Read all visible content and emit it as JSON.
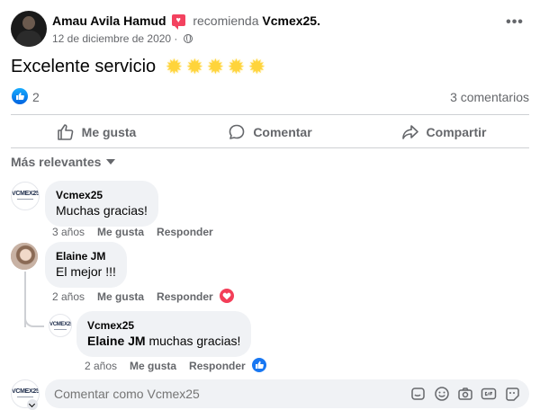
{
  "post": {
    "author": "Amau Avila Hamud",
    "recommend_text": "recomienda",
    "page": "Vcmex25.",
    "date": "12 de diciembre de 2020",
    "date_sep": " · ",
    "text": "Excelente servicio",
    "star_count": 5,
    "more_icon": "•••"
  },
  "reactions": {
    "like_count": "2",
    "comments": "3 comentarios"
  },
  "actions": {
    "like": "Me gusta",
    "comment": "Comentar",
    "share": "Compartir"
  },
  "sort": {
    "label": "Más relevantes"
  },
  "logo_text": "VCMEX25",
  "comments": [
    {
      "name": "Vcmex25",
      "text": "Muchas gracias!",
      "time": "3 años",
      "like": "Me gusta",
      "reply": "Responder"
    },
    {
      "name": "Elaine JM",
      "text": "El mejor !!!",
      "time": "2 años",
      "like": "Me gusta",
      "reply": "Responder",
      "reaction": "love"
    }
  ],
  "reply": {
    "name": "Vcmex25",
    "mention": "Elaine JM",
    "text": " muchas gracias!",
    "time": "2 años",
    "like": "Me gusta",
    "reply": "Responder",
    "reaction": "like"
  },
  "composer": {
    "placeholder": "Comentar como Vcmex25"
  },
  "colors": {
    "accent": "#1877f2",
    "love": "#f33e58",
    "muted": "#65676b"
  }
}
